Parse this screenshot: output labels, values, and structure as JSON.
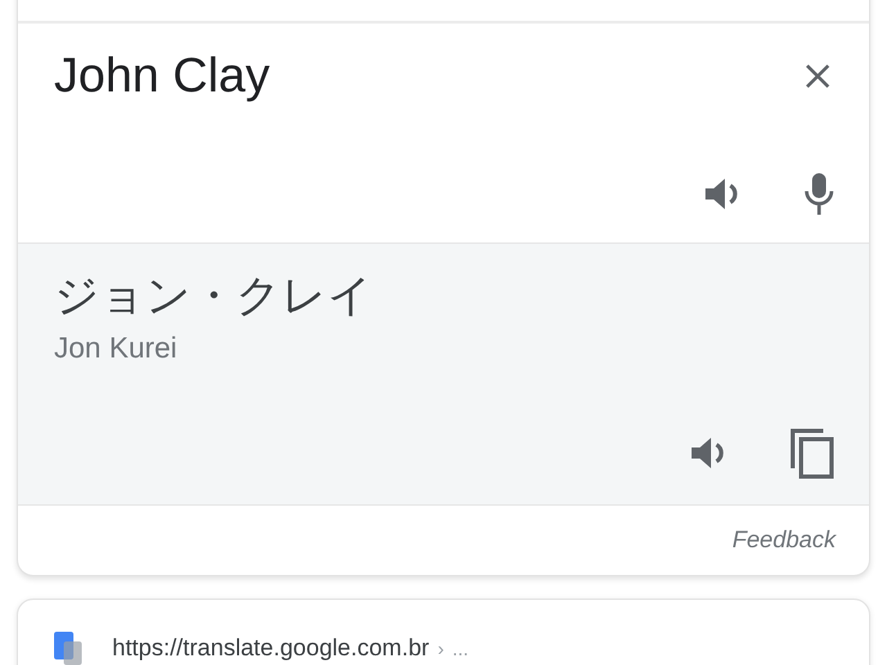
{
  "source": {
    "text": "John Clay"
  },
  "translation": {
    "text": "ジョン・クレイ",
    "romanization": "Jon Kurei"
  },
  "feedback": "Feedback",
  "result": {
    "url": "https://translate.google.com.br",
    "separator": "›",
    "path": "..."
  }
}
